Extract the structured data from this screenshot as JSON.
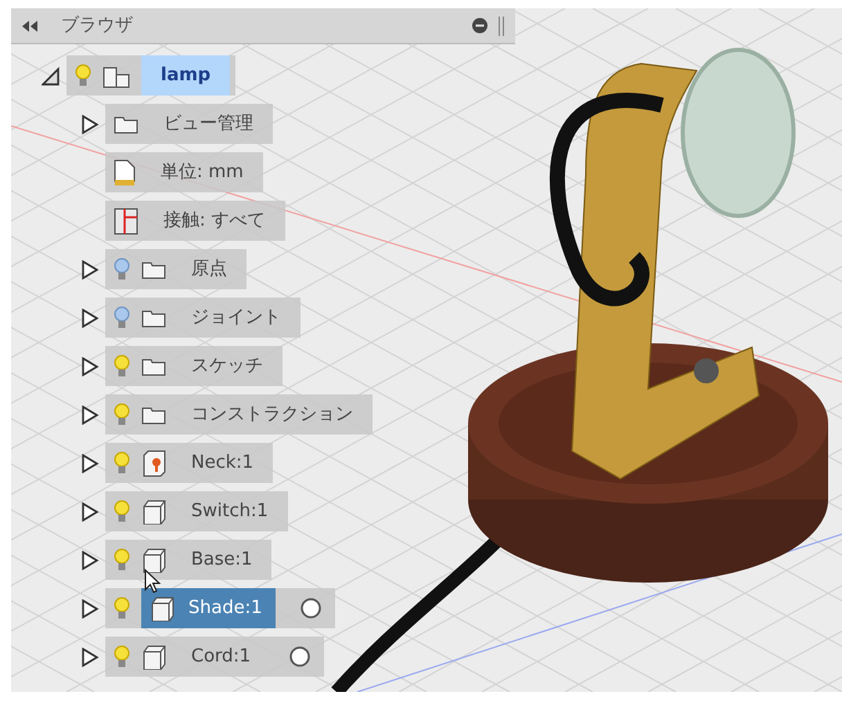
{
  "panel": {
    "title": "ブラウザ"
  },
  "tree": {
    "label": "lamp",
    "kind": "root",
    "expanded": true,
    "visible": true,
    "selected": false,
    "active": true,
    "children": [
      {
        "label": "ビュー管理",
        "kind": "folder",
        "expanded": false,
        "selected": false,
        "circle": false
      },
      {
        "label": "単位: mm",
        "kind": "units",
        "selected": false,
        "circle": false
      },
      {
        "label": "接触: すべて",
        "kind": "contact",
        "selected": false,
        "circle": false
      },
      {
        "label": "原点",
        "kind": "folder",
        "expanded": false,
        "visible": false,
        "selected": false,
        "circle": false
      },
      {
        "label": "ジョイント",
        "kind": "folder",
        "expanded": false,
        "visible": false,
        "selected": false,
        "circle": false
      },
      {
        "label": "スケッチ",
        "kind": "folder",
        "expanded": false,
        "visible": true,
        "selected": false,
        "circle": false
      },
      {
        "label": "コンストラクション",
        "kind": "folder",
        "expanded": false,
        "visible": true,
        "selected": false,
        "circle": false
      },
      {
        "label": "Neck:1",
        "kind": "grounded",
        "expanded": false,
        "visible": true,
        "selected": false,
        "circle": false
      },
      {
        "label": "Switch:1",
        "kind": "component",
        "expanded": false,
        "visible": true,
        "selected": false,
        "circle": false
      },
      {
        "label": "Base:1",
        "kind": "component",
        "expanded": false,
        "visible": true,
        "selected": false,
        "circle": false
      },
      {
        "label": "Shade:1",
        "kind": "component",
        "expanded": false,
        "visible": true,
        "selected": true,
        "circle": true
      },
      {
        "label": "Cord:1",
        "kind": "component",
        "expanded": false,
        "visible": true,
        "selected": false,
        "circle": true
      }
    ]
  }
}
